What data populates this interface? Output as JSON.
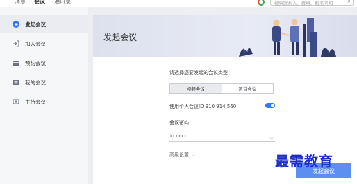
{
  "topbar": {
    "tabs": [
      "消息",
      "会议",
      "通讯录"
    ],
    "active_tab": "会议",
    "search_placeholder": "搜索联系人、群组、服务号和"
  },
  "sidebar": {
    "items": [
      {
        "label": "发起会议",
        "icon": "video-icon",
        "active": true
      },
      {
        "label": "加入会议",
        "icon": "join-icon"
      },
      {
        "label": "预约会议",
        "icon": "calendar-icon"
      },
      {
        "label": "我的会议",
        "icon": "list-icon"
      },
      {
        "label": "主持会议",
        "icon": "host-icon"
      }
    ]
  },
  "main": {
    "title": "发起会议",
    "type_prompt": "请选择您要发起的会议类型：",
    "types": [
      "视频会议",
      "语音会议"
    ],
    "selected_type": "视频会议",
    "personal_id_label": "使用个人会议ID 910 914 560",
    "personal_id_enabled": true,
    "password_label": "会议密码",
    "password_value": "••••••",
    "advanced_label": "高级设置",
    "start_button": "发起会议"
  },
  "watermark": "最需教育",
  "colors": {
    "accent": "#2f7cf6",
    "watermark": "#1c2cc8"
  }
}
